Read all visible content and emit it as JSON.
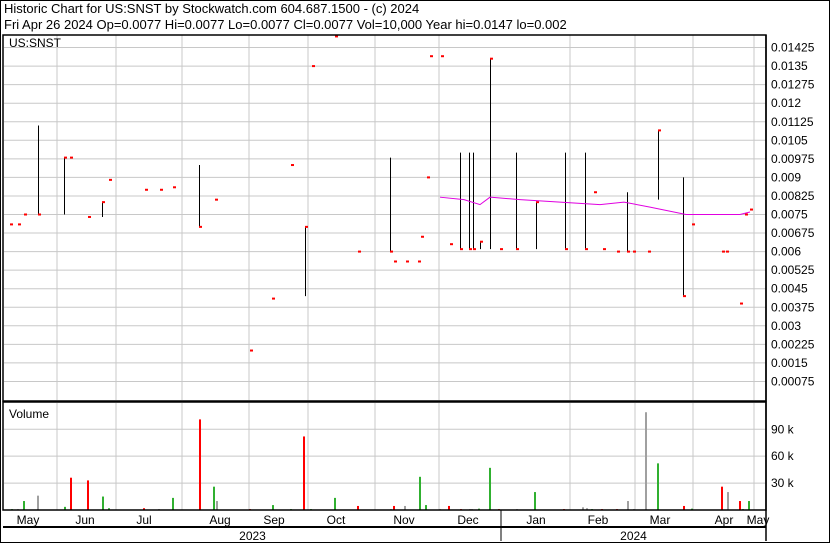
{
  "header": {
    "title": "Historic Chart for US:SNST by Stockwatch.com 604.687.1500 - (c) 2024",
    "quote": "Fri Apr 26 2024   Op=0.0077   Hi=0.0077   Lo=0.0077   Cl=0.0077   Vol=10,000   Year hi=0.0147   lo=0.002"
  },
  "colors": {
    "up": "#30b030",
    "down": "#ff0000",
    "flat": "#a0a0a0",
    "ma": "#e000e0",
    "grid": "#c8c8c8"
  },
  "chart_data": [
    {
      "type": "ohlc",
      "title": "US:SNST",
      "x_unit": "days since 2023-05-01",
      "xlim": [
        0,
        381
      ],
      "ylim": [
        0,
        0.015
      ],
      "grid": true,
      "y_ticks": [
        "0.00075",
        "0.0015",
        "0.00225",
        "0.003",
        "0.00375",
        "0.0045",
        "0.00525",
        "0.006",
        "0.00675",
        "0.0075",
        "0.00825",
        "0.009",
        "0.00975",
        "0.0105",
        "0.01125",
        "0.012",
        "0.01275",
        "0.0135",
        "0.01425"
      ],
      "bars": [
        {
          "d": 3,
          "h": 0.0071,
          "l": 0.0071,
          "c": 0.0071
        },
        {
          "d": 7,
          "h": 0.0071,
          "l": 0.0071,
          "c": 0.0071
        },
        {
          "d": 10,
          "h": 0.0075,
          "l": 0.0075,
          "c": 0.0075
        },
        {
          "d": 17,
          "h": 0.0111,
          "l": 0.0075,
          "c": 0.0075
        },
        {
          "d": 30,
          "h": 0.0098,
          "l": 0.0075,
          "c": 0.0098
        },
        {
          "d": 33,
          "h": 0.0098,
          "l": 0.0098,
          "c": 0.0098
        },
        {
          "d": 42,
          "h": 0.0074,
          "l": 0.0074,
          "c": 0.0074
        },
        {
          "d": 49,
          "h": 0.008,
          "l": 0.0074,
          "c": 0.008
        },
        {
          "d": 52.5,
          "h": 0.0089,
          "l": 0.0089,
          "c": 0.0089
        },
        {
          "d": 70.5,
          "h": 0.0085,
          "l": 0.0085,
          "c": 0.0085
        },
        {
          "d": 78,
          "h": 0.0085,
          "l": 0.0085,
          "c": 0.0085
        },
        {
          "d": 84.5,
          "h": 0.0086,
          "l": 0.0086,
          "c": 0.0086
        },
        {
          "d": 97.5,
          "h": 0.0095,
          "l": 0.007,
          "c": 0.007
        },
        {
          "d": 105.5,
          "h": 0.0081,
          "l": 0.0081,
          "c": 0.0081
        },
        {
          "d": 123,
          "h": 0.002,
          "l": 0.002,
          "c": 0.002
        },
        {
          "d": 134,
          "h": 0.0041,
          "l": 0.0041,
          "c": 0.0041
        },
        {
          "d": 143.5,
          "h": 0.0095,
          "l": 0.0095,
          "c": 0.0095
        },
        {
          "d": 150.5,
          "h": 0.007,
          "l": 0.0042,
          "c": 0.007
        },
        {
          "d": 154,
          "h": 0.0135,
          "l": 0.0135,
          "c": 0.0135
        },
        {
          "d": 165.5,
          "h": 0.0147,
          "l": 0.0147,
          "c": 0.0147
        },
        {
          "d": 177,
          "h": 0.006,
          "l": 0.006,
          "c": 0.006
        },
        {
          "d": 193,
          "h": 0.0098,
          "l": 0.006,
          "c": 0.006
        },
        {
          "d": 195,
          "h": 0.0056,
          "l": 0.0056,
          "c": 0.0056
        },
        {
          "d": 201,
          "h": 0.0056,
          "l": 0.0056,
          "c": 0.0056
        },
        {
          "d": 207,
          "h": 0.0056,
          "l": 0.0056,
          "c": 0.0056
        },
        {
          "d": 208.5,
          "h": 0.0066,
          "l": 0.0066,
          "c": 0.0066
        },
        {
          "d": 211.5,
          "h": 0.009,
          "l": 0.009,
          "c": 0.009
        },
        {
          "d": 213,
          "h": 0.0139,
          "l": 0.0139,
          "c": 0.0139
        },
        {
          "d": 218.5,
          "h": 0.0139,
          "l": 0.0139,
          "c": 0.0139
        },
        {
          "d": 223,
          "h": 0.0063,
          "l": 0.0063,
          "c": 0.0063
        },
        {
          "d": 228,
          "h": 0.01,
          "l": 0.0061,
          "c": 0.0061
        },
        {
          "d": 232.5,
          "h": 0.01,
          "l": 0.0061,
          "c": 0.0061
        },
        {
          "d": 234.5,
          "h": 0.01,
          "l": 0.0061,
          "c": 0.0061
        },
        {
          "d": 238,
          "h": 0.0064,
          "l": 0.0061,
          "c": 0.0064
        },
        {
          "d": 243,
          "h": 0.0138,
          "l": 0.0061,
          "c": 0.0138
        },
        {
          "d": 248,
          "h": 0.0061,
          "l": 0.0061,
          "c": 0.0061
        },
        {
          "d": 256,
          "h": 0.01,
          "l": 0.0061,
          "c": 0.0061
        },
        {
          "d": 266,
          "h": 0.008,
          "l": 0.0061,
          "c": 0.008
        },
        {
          "d": 280.5,
          "h": 0.01,
          "l": 0.0061,
          "c": 0.0061
        },
        {
          "d": 290.5,
          "h": 0.01,
          "l": 0.0061,
          "c": 0.0061
        },
        {
          "d": 295,
          "h": 0.0084,
          "l": 0.0084,
          "c": 0.0084
        },
        {
          "d": 299.5,
          "h": 0.0061,
          "l": 0.0061,
          "c": 0.0061
        },
        {
          "d": 306.5,
          "h": 0.006,
          "l": 0.006,
          "c": 0.006
        },
        {
          "d": 311.5,
          "h": 0.0084,
          "l": 0.006,
          "c": 0.006
        },
        {
          "d": 314.5,
          "h": 0.006,
          "l": 0.006,
          "c": 0.006
        },
        {
          "d": 322,
          "h": 0.006,
          "l": 0.006,
          "c": 0.006
        },
        {
          "d": 327,
          "h": 0.0109,
          "l": 0.0081,
          "c": 0.0109
        },
        {
          "d": 339.5,
          "h": 0.009,
          "l": 0.0042,
          "c": 0.0042
        },
        {
          "d": 344,
          "h": 0.0071,
          "l": 0.0071,
          "c": 0.0071
        },
        {
          "d": 359,
          "h": 0.006,
          "l": 0.006,
          "c": 0.006
        },
        {
          "d": 361,
          "h": 0.006,
          "l": 0.006,
          "c": 0.006
        },
        {
          "d": 368,
          "h": 0.0039,
          "l": 0.0039,
          "c": 0.0039
        },
        {
          "d": 370.5,
          "h": 0.0075,
          "l": 0.0075,
          "c": 0.0075
        },
        {
          "d": 373,
          "h": 0.0077,
          "l": 0.0077,
          "c": 0.0077
        }
      ],
      "moving_average": [
        [
          218,
          0.0082
        ],
        [
          230,
          0.0081
        ],
        [
          238,
          0.0079
        ],
        [
          243,
          0.0082
        ],
        [
          258,
          0.0081
        ],
        [
          298,
          0.0079
        ],
        [
          310,
          0.008
        ],
        [
          323,
          0.0078
        ],
        [
          341,
          0.0075
        ],
        [
          368,
          0.0075
        ],
        [
          373,
          0.0076
        ]
      ]
    },
    {
      "type": "bar",
      "title": "Volume",
      "x_unit": "days since 2023-05-01",
      "ylim": [
        0,
        115000
      ],
      "y_ticks": [
        "30 k",
        "60 k",
        "90 k"
      ],
      "y_tick_values": [
        30000,
        60000,
        90000
      ],
      "x_month_labels": [
        "May",
        "Jun",
        "Jul",
        "Aug",
        "Sep",
        "Oct",
        "Nov",
        "Dec",
        "Jan",
        "Feb",
        "Mar",
        "Apr",
        "May"
      ],
      "x_month_days": [
        12,
        40.5,
        70,
        108,
        135,
        166,
        200,
        232,
        266,
        297,
        328,
        360,
        377
      ],
      "month_grid_days": [
        26.5,
        56,
        89,
        122.5,
        152,
        185.5,
        217.5,
        283,
        315.5,
        344.5,
        375
      ],
      "years": [
        "2023",
        "2024"
      ],
      "year_divider_day": 248.5,
      "bars": [
        {
          "d": 3.3,
          "v": 1000,
          "c": "up"
        },
        {
          "d": 6.5,
          "v": 1000,
          "c": "flat"
        },
        {
          "d": 9.4,
          "v": 10000,
          "c": "up"
        },
        {
          "d": 16.3,
          "v": 16000,
          "c": "flat"
        },
        {
          "d": 30,
          "v": 3500,
          "c": "up"
        },
        {
          "d": 33,
          "v": 36000,
          "c": "down"
        },
        {
          "d": 41.4,
          "v": 33000,
          "c": "down"
        },
        {
          "d": 49,
          "v": 15000,
          "c": "up"
        },
        {
          "d": 52,
          "v": 2000,
          "c": "up"
        },
        {
          "d": 69.5,
          "v": 2000,
          "c": "down"
        },
        {
          "d": 77,
          "v": 1000,
          "c": "flat"
        },
        {
          "d": 84,
          "v": 13500,
          "c": "up"
        },
        {
          "d": 97.3,
          "v": 101000,
          "c": "down"
        },
        {
          "d": 104.4,
          "v": 26000,
          "c": "up"
        },
        {
          "d": 106,
          "v": 10000,
          "c": "flat"
        },
        {
          "d": 122.4,
          "v": 1000,
          "c": "down"
        },
        {
          "d": 134,
          "v": 5500,
          "c": "up"
        },
        {
          "d": 143,
          "v": 1000,
          "c": "up"
        },
        {
          "d": 149.7,
          "v": 82000,
          "c": "down"
        },
        {
          "d": 153,
          "v": 1000,
          "c": "up"
        },
        {
          "d": 165,
          "v": 13500,
          "c": "up"
        },
        {
          "d": 176.7,
          "v": 4500,
          "c": "down"
        },
        {
          "d": 193,
          "v": 1000,
          "c": "flat"
        },
        {
          "d": 194.4,
          "v": 4500,
          "c": "down"
        },
        {
          "d": 200,
          "v": 4500,
          "c": "flat"
        },
        {
          "d": 207.4,
          "v": 37000,
          "c": "up"
        },
        {
          "d": 210.3,
          "v": 5500,
          "c": "up"
        },
        {
          "d": 217.7,
          "v": 1000,
          "c": "flat"
        },
        {
          "d": 222,
          "v": 4500,
          "c": "down"
        },
        {
          "d": 227.8,
          "v": 1000,
          "c": "down"
        },
        {
          "d": 232.3,
          "v": 1000,
          "c": "flat"
        },
        {
          "d": 233.6,
          "v": 1000,
          "c": "flat"
        },
        {
          "d": 237,
          "v": 1500,
          "c": "up"
        },
        {
          "d": 242.3,
          "v": 47000,
          "c": "up"
        },
        {
          "d": 247,
          "v": 1000,
          "c": "down"
        },
        {
          "d": 256,
          "v": 1000,
          "c": "flat"
        },
        {
          "d": 264.8,
          "v": 20000,
          "c": "up"
        },
        {
          "d": 279.4,
          "v": 1000,
          "c": "down"
        },
        {
          "d": 289,
          "v": 3000,
          "c": "flat"
        },
        {
          "d": 291,
          "v": 2000,
          "c": "flat"
        },
        {
          "d": 293.7,
          "v": 1000,
          "c": "up"
        },
        {
          "d": 298.4,
          "v": 1000,
          "c": "down"
        },
        {
          "d": 305.8,
          "v": 1000,
          "c": "down"
        },
        {
          "d": 311.4,
          "v": 10000,
          "c": "flat"
        },
        {
          "d": 314.6,
          "v": 1000,
          "c": "flat"
        },
        {
          "d": 320.7,
          "v": 109000,
          "c": "flat"
        },
        {
          "d": 326.5,
          "v": 52000,
          "c": "up"
        },
        {
          "d": 339.5,
          "v": 4500,
          "c": "down"
        },
        {
          "d": 343.7,
          "v": 1500,
          "c": "up"
        },
        {
          "d": 358.5,
          "v": 26000,
          "c": "down"
        },
        {
          "d": 361.7,
          "v": 20000,
          "c": "flat"
        },
        {
          "d": 367.3,
          "v": 10000,
          "c": "down"
        },
        {
          "d": 368.8,
          "v": 1000,
          "c": "up"
        },
        {
          "d": 372,
          "v": 10000,
          "c": "up"
        }
      ]
    }
  ]
}
